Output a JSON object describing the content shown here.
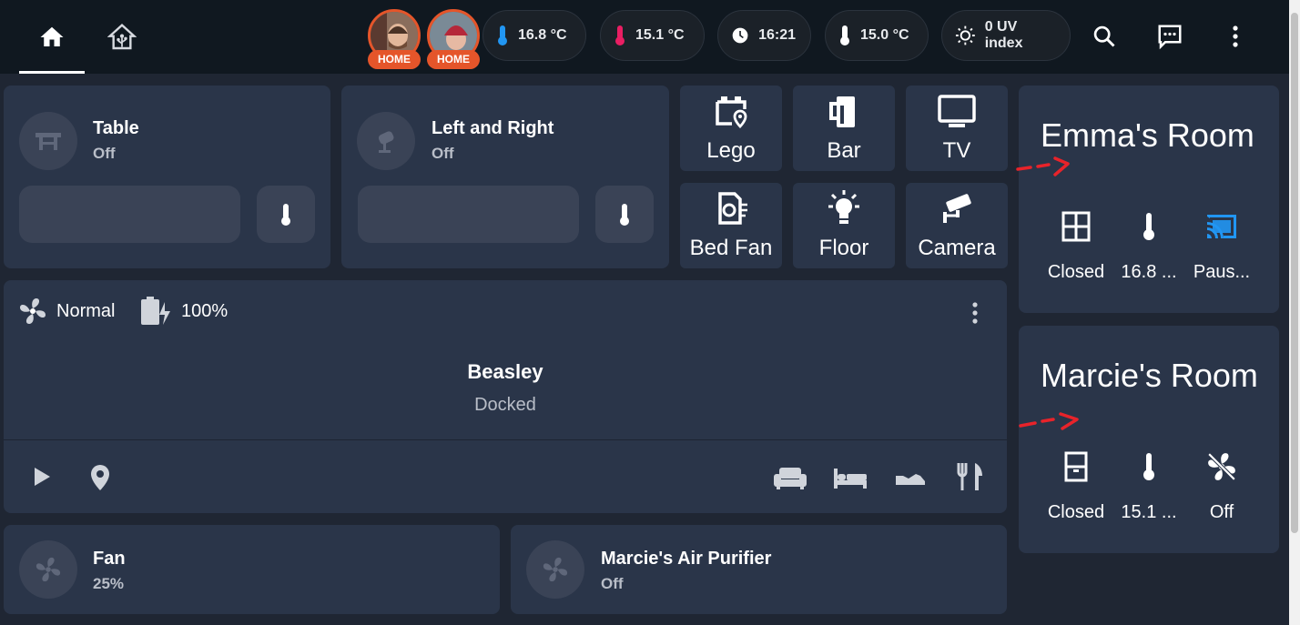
{
  "header": {
    "tabs": [
      {
        "icon": "home-icon",
        "active": true
      },
      {
        "icon": "home-assistant-icon",
        "active": false
      }
    ],
    "persons": [
      {
        "badge": "HOME"
      },
      {
        "badge": "HOME"
      }
    ],
    "chips": [
      {
        "icon": "thermometer-blue-icon",
        "value": "16.8 °C",
        "icon_color": "#2196f3"
      },
      {
        "icon": "thermometer-red-icon",
        "value": "15.1 °C",
        "icon_color": "#e91e63"
      },
      {
        "icon": "clock-icon",
        "value": "16:21",
        "icon_color": "#ffffff"
      },
      {
        "icon": "thermometer-icon",
        "value": "15.0 °C",
        "icon_color": "#ffffff"
      },
      {
        "icon": "uv-sun-icon",
        "value": "0 UV index",
        "icon_color": "#ffffff"
      }
    ]
  },
  "tiles": [
    {
      "name": "Table",
      "state": "Off"
    },
    {
      "name": "Left and Right",
      "state": "Off"
    }
  ],
  "buttons": [
    {
      "label": "Lego",
      "icon": "lego-location-icon"
    },
    {
      "label": "Bar",
      "icon": "beer-mug-icon"
    },
    {
      "label": "TV",
      "icon": "television-icon"
    },
    {
      "label": "Bed Fan",
      "icon": "fan-outlet-icon"
    },
    {
      "label": "Floor",
      "icon": "lightbulb-on-icon"
    },
    {
      "label": "Camera",
      "icon": "cctv-camera-icon"
    }
  ],
  "vacuum": {
    "fan_speed": "Normal",
    "battery": "100%",
    "name": "Beasley",
    "state": "Docked"
  },
  "fans": [
    {
      "name": "Fan",
      "state": "25%"
    },
    {
      "name": "Marcie's Air Purifier",
      "state": "Off"
    }
  ],
  "rooms": [
    {
      "title": "Emma's Room",
      "items": [
        {
          "icon": "window-closed-icon",
          "label": "Closed"
        },
        {
          "icon": "thermometer-icon",
          "label": "16.8 ..."
        },
        {
          "icon": "cast-connected-icon",
          "label": "Paus..."
        }
      ]
    },
    {
      "title": "Marcie's Room",
      "items": [
        {
          "icon": "door-closed-icon",
          "label": "Closed"
        },
        {
          "icon": "thermometer-icon",
          "label": "15.1 ..."
        },
        {
          "icon": "fan-off-icon",
          "label": "Off"
        }
      ]
    }
  ],
  "colors": {
    "header_bg": "#101820",
    "page_bg": "#1f2633",
    "card_bg": "#2a3549",
    "badge": "#e5552a",
    "cast_active": "#2196f3",
    "annotation_arrow": "#e8232a"
  }
}
